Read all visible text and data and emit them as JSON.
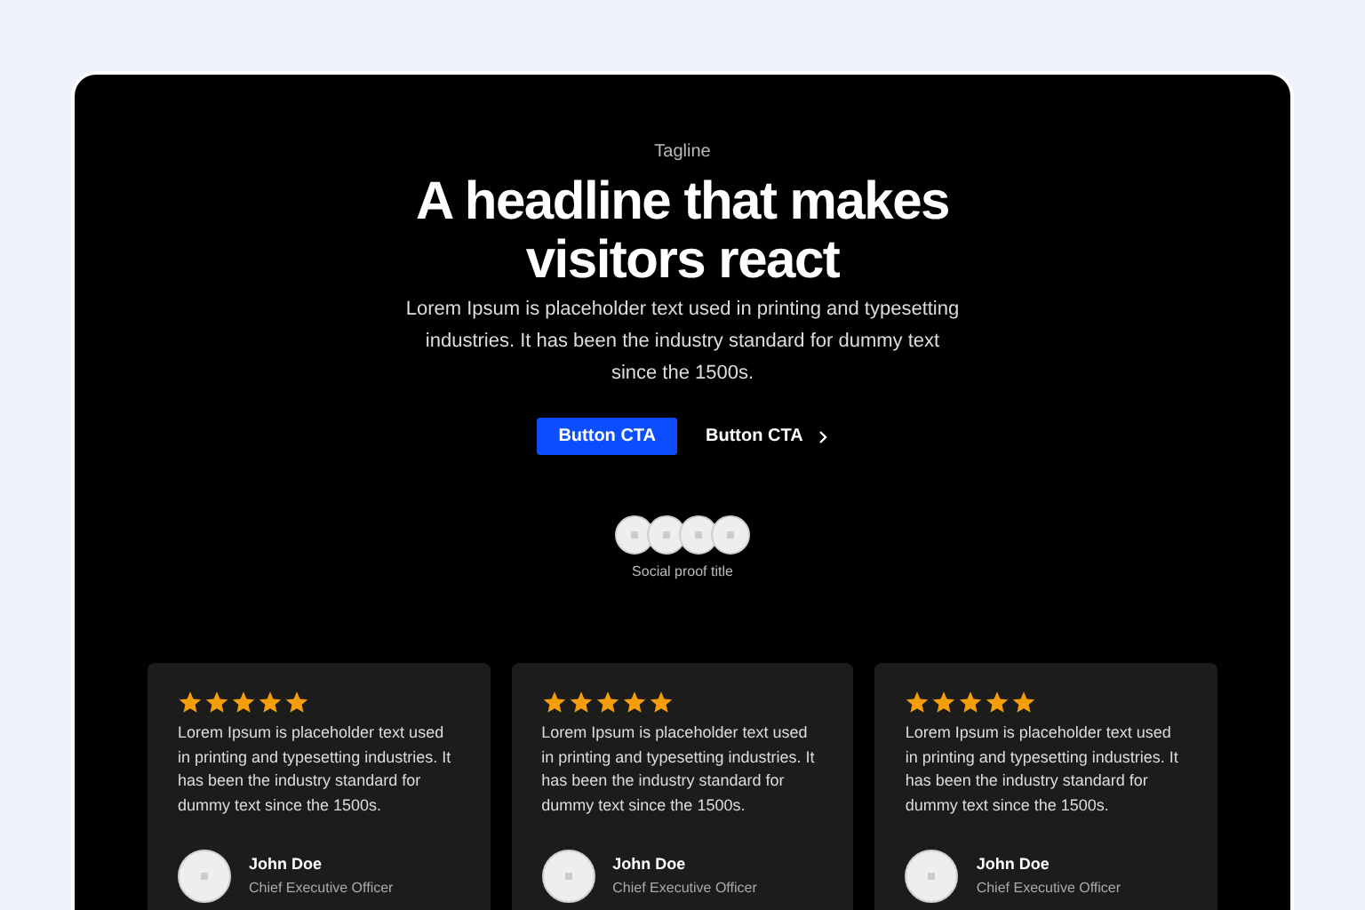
{
  "hero": {
    "tagline": "Tagline",
    "headline": "A headline that makes visitors react",
    "body": "Lorem Ipsum is placeholder text used in printing and typesetting industries. It has been the industry standard for dummy text since the 1500s.",
    "buttons": [
      {
        "label": "Button CTA",
        "kind": "primary"
      },
      {
        "label": "Button CTA",
        "kind": "link"
      }
    ]
  },
  "social_proof": {
    "avatars": [
      {
        "kind": "placeholder"
      },
      {
        "kind": "placeholder"
      },
      {
        "kind": "placeholder"
      },
      {
        "kind": "placeholder"
      }
    ],
    "title": "Social proof title"
  },
  "testimonials": [
    {
      "stars": 5,
      "quote": "Lorem Ipsum is placeholder text used in printing and typesetting industries. It has been the industry standard for dummy text since the 1500s.",
      "name": "John Doe",
      "role": "Chief Executive Officer"
    },
    {
      "stars": 5,
      "quote": "Lorem Ipsum is placeholder text used in printing and typesetting industries. It has been the industry standard for dummy text since the 1500s.",
      "name": "John Doe",
      "role": "Chief Executive Officer"
    },
    {
      "stars": 5,
      "quote": "Lorem Ipsum is placeholder text used in printing and typesetting industries. It has been the industry standard for dummy text since the 1500s.",
      "name": "John Doe",
      "role": "Chief Executive Officer"
    }
  ]
}
